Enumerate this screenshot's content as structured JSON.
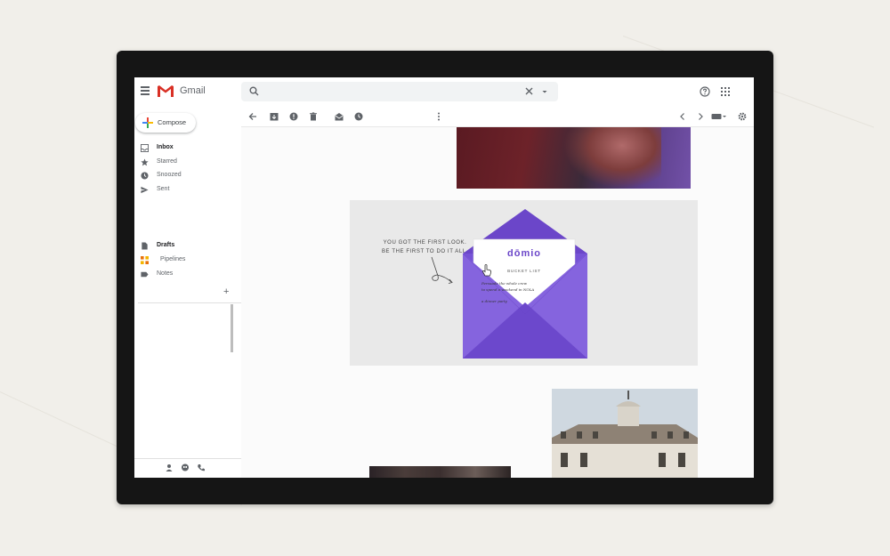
{
  "app": {
    "name": "Gmail"
  },
  "compose": {
    "label": "Compose"
  },
  "nav": [
    {
      "label": "Inbox",
      "icon": "inbox-icon",
      "bold": true
    },
    {
      "label": "Starred",
      "icon": "star-icon",
      "bold": false
    },
    {
      "label": "Snoozed",
      "icon": "clock-icon",
      "bold": false
    },
    {
      "label": "Sent",
      "icon": "send-icon",
      "bold": false
    },
    {
      "label": "Drafts",
      "icon": "file-icon",
      "bold": true
    },
    {
      "label": "Pipelines",
      "icon": "pipelines-icon",
      "bold": false
    },
    {
      "label": "Notes",
      "icon": "label-icon",
      "bold": false
    }
  ],
  "labels_section": {
    "add": "+"
  },
  "search": {
    "value": "",
    "placeholder": ""
  },
  "promo": {
    "headline_line1": "YOU GOT THE FIRST LOOK.",
    "headline_line2": "BE THE FIRST TO DO IT ALL.",
    "brand": "dōmio",
    "card_title": "BUCKET LIST",
    "card_item1": "Persuade the whole crew",
    "card_item2": "to spend a weekend in NOLA",
    "card_item3": "a dinner party",
    "envelope_color": "#7653d6"
  },
  "colors": {
    "accent": "#7653d6",
    "gmail_red": "#d93025",
    "text": "#5f6368"
  }
}
